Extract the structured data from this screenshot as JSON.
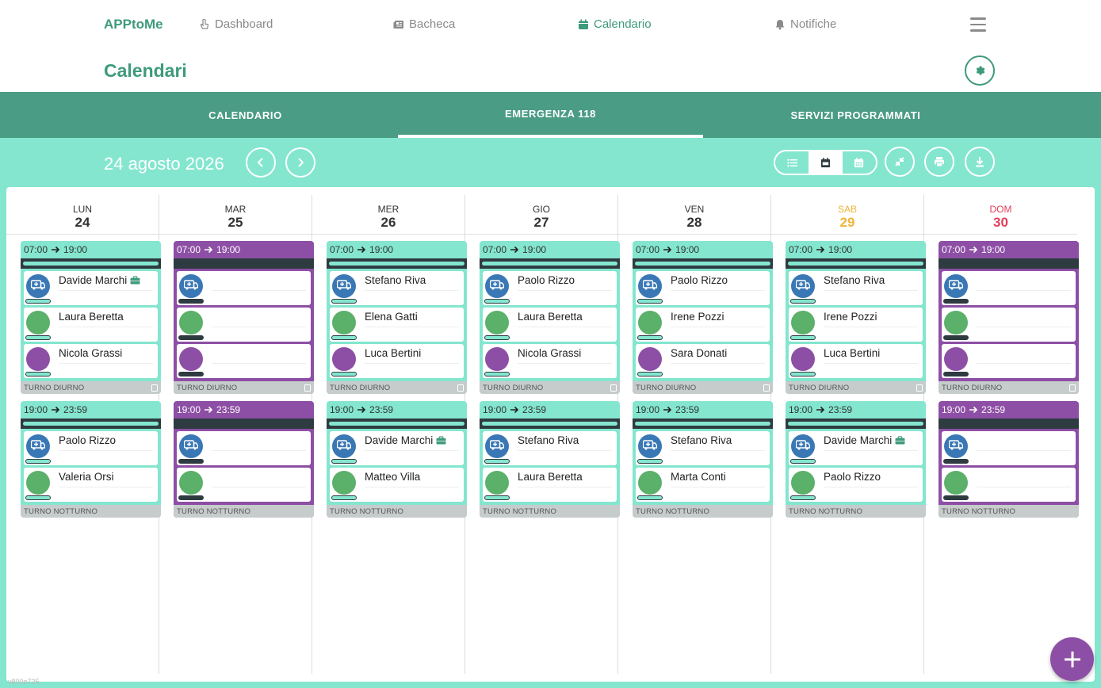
{
  "nav": {
    "brand": "APPtoMe",
    "items": [
      {
        "label": "Dashboard",
        "icon": "hand-pointer-icon"
      },
      {
        "label": "Bacheca",
        "icon": "newspaper-icon"
      },
      {
        "label": "Calendario",
        "icon": "calendar-icon"
      },
      {
        "label": "Notifiche",
        "icon": "bell-icon"
      }
    ]
  },
  "page": {
    "title": "Calendari"
  },
  "tabs": [
    "CALENDARIO",
    "EMERGENZA 118",
    "SERVIZI PROGRAMMATI"
  ],
  "active_tab": "EMERGENZA 118",
  "toolbar": {
    "date": "24 agosto 2026"
  },
  "colors": {
    "accent": "#3e9a7c",
    "mint": "#84e6cf",
    "purple": "#8d4fa5",
    "saturday": "#f0b43a",
    "sunday": "#e0405c"
  },
  "days": [
    {
      "name": "LUN",
      "num": "24",
      "kind": "week",
      "day": {
        "time_start": "07:00",
        "time_end": "19:00",
        "color": "mint",
        "label": "TURNO DIURNO",
        "members": [
          "Davide Marchi",
          "Laura Beretta",
          "Nicola Grassi"
        ],
        "badge0": true
      },
      "night": {
        "time_start": "19:00",
        "time_end": "23:59",
        "color": "mint",
        "label": "TURNO NOTTURNO",
        "members": [
          "Paolo Rizzo",
          "Valeria Orsi"
        ],
        "badge0": false
      }
    },
    {
      "name": "MAR",
      "num": "25",
      "kind": "week",
      "day": {
        "time_start": "07:00",
        "time_end": "19:00",
        "color": "purple",
        "label": "TURNO DIURNO",
        "members": [
          "",
          "",
          ""
        ],
        "badge0": false
      },
      "night": {
        "time_start": "19:00",
        "time_end": "23:59",
        "color": "purple",
        "label": "TURNO NOTTURNO",
        "members": [
          "",
          ""
        ],
        "badge0": false
      }
    },
    {
      "name": "MER",
      "num": "26",
      "kind": "week",
      "day": {
        "time_start": "07:00",
        "time_end": "19:00",
        "color": "mint",
        "label": "TURNO DIURNO",
        "members": [
          "Stefano Riva",
          "Elena Gatti",
          "Luca Bertini"
        ],
        "badge0": false
      },
      "night": {
        "time_start": "19:00",
        "time_end": "23:59",
        "color": "mint",
        "label": "TURNO NOTTURNO",
        "members": [
          "Davide Marchi",
          "Matteo Villa"
        ],
        "badge0": true
      }
    },
    {
      "name": "GIO",
      "num": "27",
      "kind": "week",
      "day": {
        "time_start": "07:00",
        "time_end": "19:00",
        "color": "mint",
        "label": "TURNO DIURNO",
        "members": [
          "Paolo Rizzo",
          "Laura Beretta",
          "Nicola Grassi"
        ],
        "badge0": false
      },
      "night": {
        "time_start": "19:00",
        "time_end": "23:59",
        "color": "mint",
        "label": "TURNO NOTTURNO",
        "members": [
          "Stefano Riva",
          "Laura Beretta"
        ],
        "badge0": false
      }
    },
    {
      "name": "VEN",
      "num": "28",
      "kind": "week",
      "day": {
        "time_start": "07:00",
        "time_end": "19:00",
        "color": "mint",
        "label": "TURNO DIURNO",
        "members": [
          "Paolo Rizzo",
          "Irene Pozzi",
          "Sara Donati"
        ],
        "badge0": false
      },
      "night": {
        "time_start": "19:00",
        "time_end": "23:59",
        "color": "mint",
        "label": "TURNO NOTTURNO",
        "members": [
          "Stefano Riva",
          "Marta Conti"
        ],
        "badge0": false
      }
    },
    {
      "name": "SAB",
      "num": "29",
      "kind": "sat",
      "day": {
        "time_start": "07:00",
        "time_end": "19:00",
        "color": "mint",
        "label": "TURNO DIURNO",
        "members": [
          "Stefano Riva",
          "Irene Pozzi",
          "Luca Bertini"
        ],
        "badge0": false
      },
      "night": {
        "time_start": "19:00",
        "time_end": "23:59",
        "color": "mint",
        "label": "TURNO NOTTURNO",
        "members": [
          "Davide Marchi",
          "Paolo Rizzo"
        ],
        "badge0": true
      }
    },
    {
      "name": "DOM",
      "num": "30",
      "kind": "sun",
      "day": {
        "time_start": "07:00",
        "time_end": "19:00",
        "color": "purple",
        "label": "TURNO DIURNO",
        "members": [
          "",
          "",
          ""
        ],
        "badge0": false
      },
      "night": {
        "time_start": "19:00",
        "time_end": "23:59",
        "color": "purple",
        "label": "TURNO NOTTURNO",
        "members": [
          "",
          ""
        ],
        "badge0": false
      }
    }
  ],
  "version": "v800e725"
}
